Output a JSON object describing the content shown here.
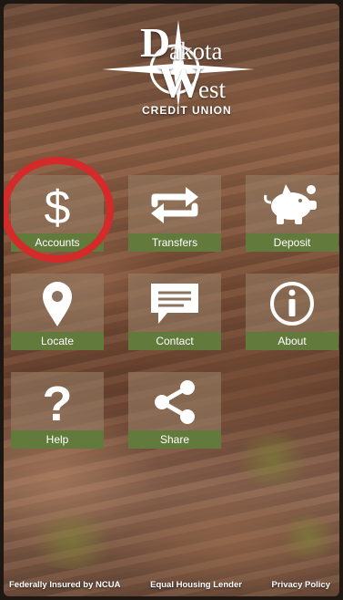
{
  "logo": {
    "initial_d": "D",
    "akota": "akota",
    "initial_w": "W",
    "est": "est",
    "subtitle": "CREDIT UNION",
    "icon": "compass-star-icon"
  },
  "tiles": [
    {
      "label": "Accounts",
      "icon": "dollar-icon"
    },
    {
      "label": "Transfers",
      "icon": "transfer-arrows-icon"
    },
    {
      "label": "Deposit",
      "icon": "piggy-bank-icon"
    },
    {
      "label": "Locate",
      "icon": "map-pin-icon"
    },
    {
      "label": "Contact",
      "icon": "chat-bubble-icon"
    },
    {
      "label": "About",
      "icon": "info-icon"
    },
    {
      "label": "Help",
      "icon": "question-mark-icon"
    },
    {
      "label": "Share",
      "icon": "share-icon"
    }
  ],
  "footer": {
    "ncua": "Federally Insured by NCUA",
    "housing": "Equal Housing Lender",
    "privacy": "Privacy Policy"
  },
  "colors": {
    "tile_label_bg": "#627a3c",
    "highlight_circle": "#d42a2a"
  }
}
